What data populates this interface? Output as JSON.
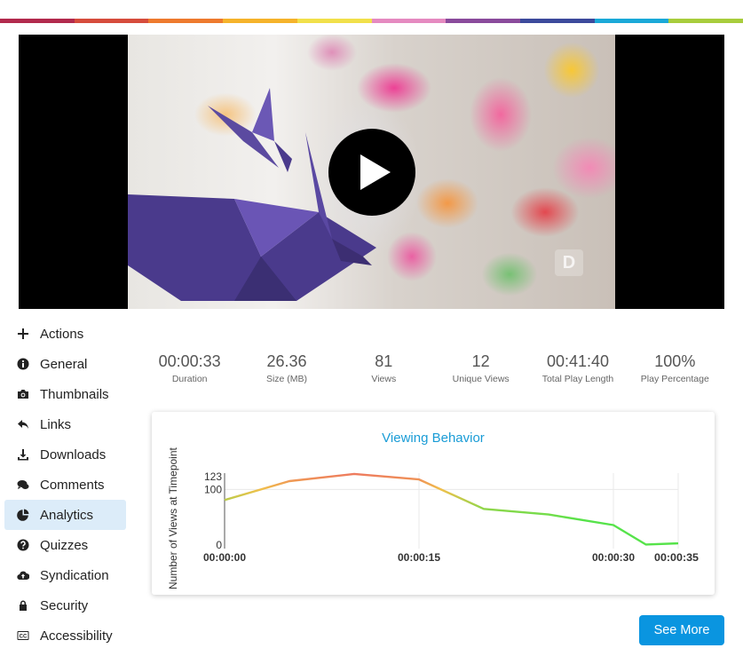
{
  "stripe_colors": [
    "#b22a4d",
    "#d64c3c",
    "#ee7a2e",
    "#f5b32b",
    "#f1e04a",
    "#e58ac0",
    "#8a4b9c",
    "#3c4a9c",
    "#1aa9d8",
    "#a8cd3c"
  ],
  "video": {
    "watermark": "D"
  },
  "sidebar": {
    "items": [
      {
        "label": "Actions",
        "icon": "plus-icon"
      },
      {
        "label": "General",
        "icon": "info-icon"
      },
      {
        "label": "Thumbnails",
        "icon": "camera-icon"
      },
      {
        "label": "Links",
        "icon": "reply-icon"
      },
      {
        "label": "Downloads",
        "icon": "download-icon"
      },
      {
        "label": "Comments",
        "icon": "comments-icon"
      },
      {
        "label": "Analytics",
        "icon": "pie-chart-icon",
        "active": true
      },
      {
        "label": "Quizzes",
        "icon": "question-icon"
      },
      {
        "label": "Syndication",
        "icon": "cloud-upload-icon"
      },
      {
        "label": "Security",
        "icon": "lock-icon"
      },
      {
        "label": "Accessibility",
        "icon": "closed-captions-icon"
      }
    ]
  },
  "stats": [
    {
      "value": "00:00:33",
      "label": "Duration"
    },
    {
      "value": "26.36",
      "label": "Size (MB)"
    },
    {
      "value": "81",
      "label": "Views"
    },
    {
      "value": "12",
      "label": "Unique Views"
    },
    {
      "value": "00:41:40",
      "label": "Total Play Length"
    },
    {
      "value": "100%",
      "label": "Play Percentage"
    }
  ],
  "chart_data": {
    "type": "line",
    "title": "Viewing Behavior",
    "ylabel": "Number of Views at Timepoint",
    "xlabel": "",
    "x_tick_labels": [
      "00:00:00",
      "00:00:15",
      "00:00:30",
      "00:00:35"
    ],
    "x_ticks": [
      0,
      15,
      30,
      35
    ],
    "y_tick_labels": [
      "0",
      "100",
      "123"
    ],
    "y_ticks": [
      0,
      100,
      123
    ],
    "xlim": [
      0,
      35
    ],
    "ylim": [
      0,
      123
    ],
    "grid": true,
    "series": [
      {
        "x": [
          0,
          5,
          10,
          15,
          20,
          25,
          30,
          32.5,
          35
        ],
        "values": [
          81,
          115,
          128,
          118,
          65,
          55,
          36,
          1,
          3
        ]
      }
    ],
    "gradient_colors": [
      "#56e34a",
      "#f0c04a",
      "#ee7a5e"
    ]
  },
  "see_more_label": "See More"
}
